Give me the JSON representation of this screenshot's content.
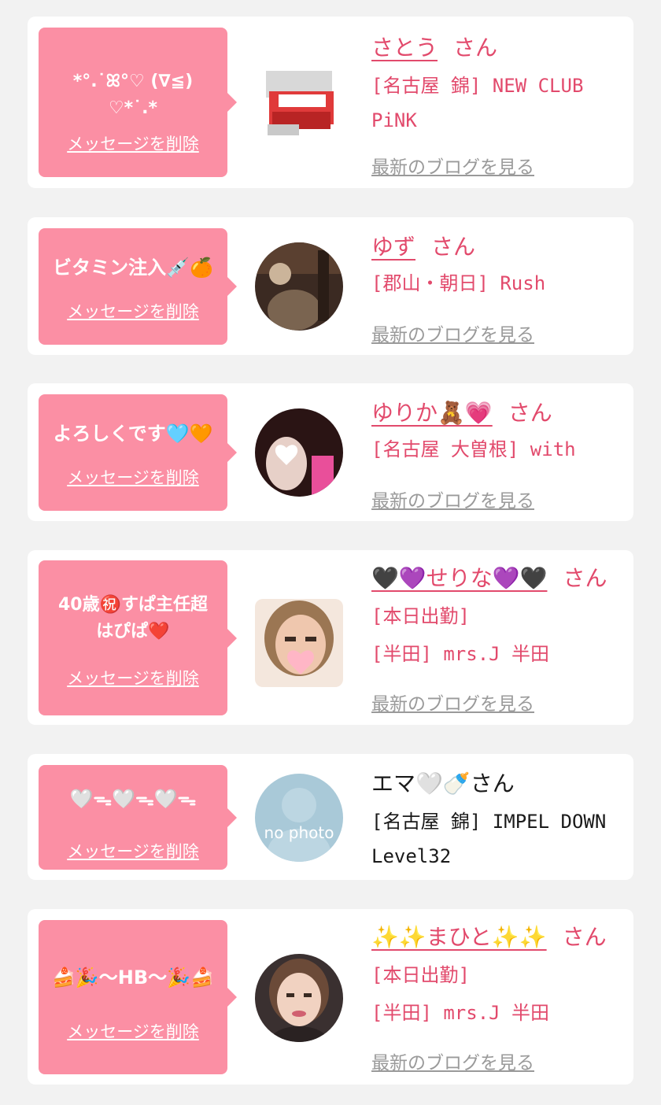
{
  "colors": {
    "background": "#f2f2f2",
    "bubble": "#fb8fa4",
    "accent": "#e24a6c",
    "link_gray": "#9a9a9a"
  },
  "delete_label": "メッセージを削除",
  "blog_label": "最新のブログを見る",
  "san": "さん",
  "entries": [
    {
      "message": "*°.˙ꕤ°♡ (∇≦)\n♡*˙.*",
      "name": "さとう",
      "shop": [
        "[名古屋 錦] NEW CLUB PiNK"
      ],
      "avatar": "product-photo"
    },
    {
      "message": "ビタミン注入💉🍊",
      "name": "ゆず",
      "shop": [
        "[郡山・朝日] Rush"
      ],
      "avatar": "photo"
    },
    {
      "message": "よろしくです🩵🧡",
      "name": "ゆりか🧸💗",
      "shop": [
        "[名古屋 大曽根] with"
      ],
      "avatar": "photo"
    },
    {
      "message": "40歳㊗️すぱ主任超\nはぴぱ❤️",
      "name": "🖤💜せりな💜🖤",
      "shop": [
        "[本日出勤]",
        "[半田] mrs.J 半田"
      ],
      "avatar": "photo"
    },
    {
      "message": "🤍ᯓ🤍ᯓ🤍ᯓ",
      "name": "エマ🤍🍼",
      "shop": [
        "[名古屋 錦] IMPEL DOWN Level32"
      ],
      "avatar": "no photo"
    },
    {
      "message": "🍰🎉〜HB〜🎉🍰",
      "name": "✨✨まひと✨✨",
      "shop": [
        "[本日出勤]",
        "[半田] mrs.J 半田"
      ],
      "avatar": "photo"
    }
  ]
}
